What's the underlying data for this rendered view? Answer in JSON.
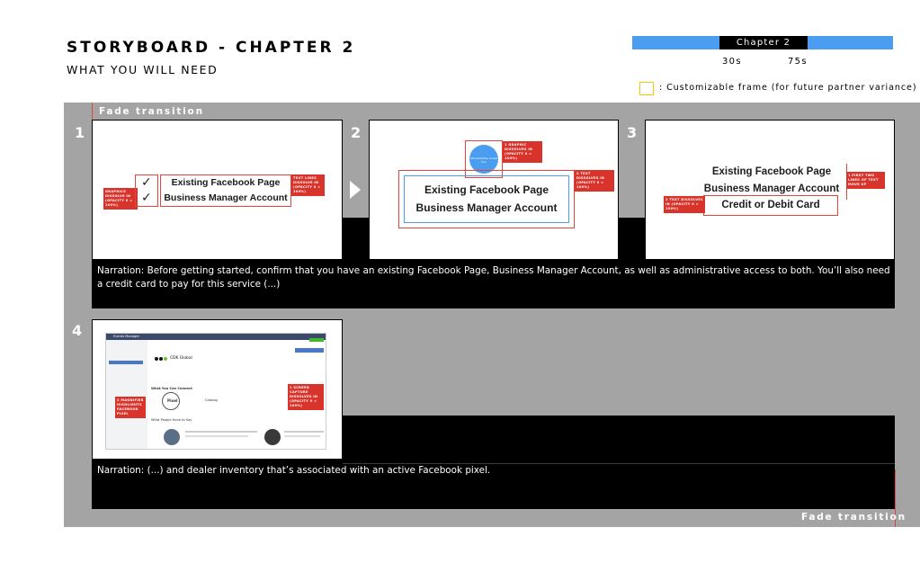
{
  "header": {
    "title": "STORYBOARD - CHAPTER 2",
    "subtitle": "WHAT YOU WILL NEED"
  },
  "timeline": {
    "chapter_label": "Chapter 2",
    "start_time": "30s",
    "end_time": "75s",
    "bar_color": "#4a9df0"
  },
  "legend": {
    "text": ": Customizable frame (for future partner variance)",
    "box_color": "#f5c518"
  },
  "board": {
    "fade_in_label": "Fade transition",
    "fade_out_label": "Fade transition"
  },
  "frames": [
    {
      "number": "1",
      "line1": "Existing Facebook Page",
      "line2": "Business Manager Account",
      "tag_left": "GRAPHICS DISSOLVE IN (OPACITY 0 > 100%)",
      "tag_right": "TEXT LINES DISSOLVE IN (OPACITY 0 > 100%)"
    },
    {
      "number": "2",
      "circle_text": "Administrative Access Icon",
      "line1": "Existing Facebook Page",
      "line2": "Business Manager Account",
      "tag_top": "1 GRAPHIC DISSOLVES IN (OPACITY 0 > 100%)",
      "tag_right": "2 TEXT DISSOLVES IN (OPACITY 0 > 100%)"
    },
    {
      "number": "3",
      "line1": "Existing Facebook Page",
      "line2": "Business Manager Account",
      "line3": "Credit or Debit Card",
      "tag_left": "2 TEXT DISSOLVES IN (OPACITY 0 > 100%)",
      "tag_right": "1 FIRST TWO LINES OF TEXT MOVE UP"
    },
    {
      "number": "4",
      "app_name": "Events Manager",
      "company": "CDK Global",
      "section_connect": "What You Can Connect",
      "pixel_label": "Pixel",
      "catalog_label": "Catalog",
      "section_people": "What People Have to Say",
      "tag_left": "2 MAGNIFIER HIGHLIGHTS FACEBOOK PIXEL",
      "tag_right": "1 SCREEN CAPTURE DISSOLVES IN (OPACITY 0 > 100%)"
    }
  ],
  "narration": {
    "row1": "Narration: Before getting started, confirm that you have an existing Facebook Page, Business Manager Account, as well as administrative access to both. You’ll also need a credit card to pay for this service (...)",
    "row2": "Narration: (...) and dealer inventory that’s associated with an active Facebook pixel."
  }
}
